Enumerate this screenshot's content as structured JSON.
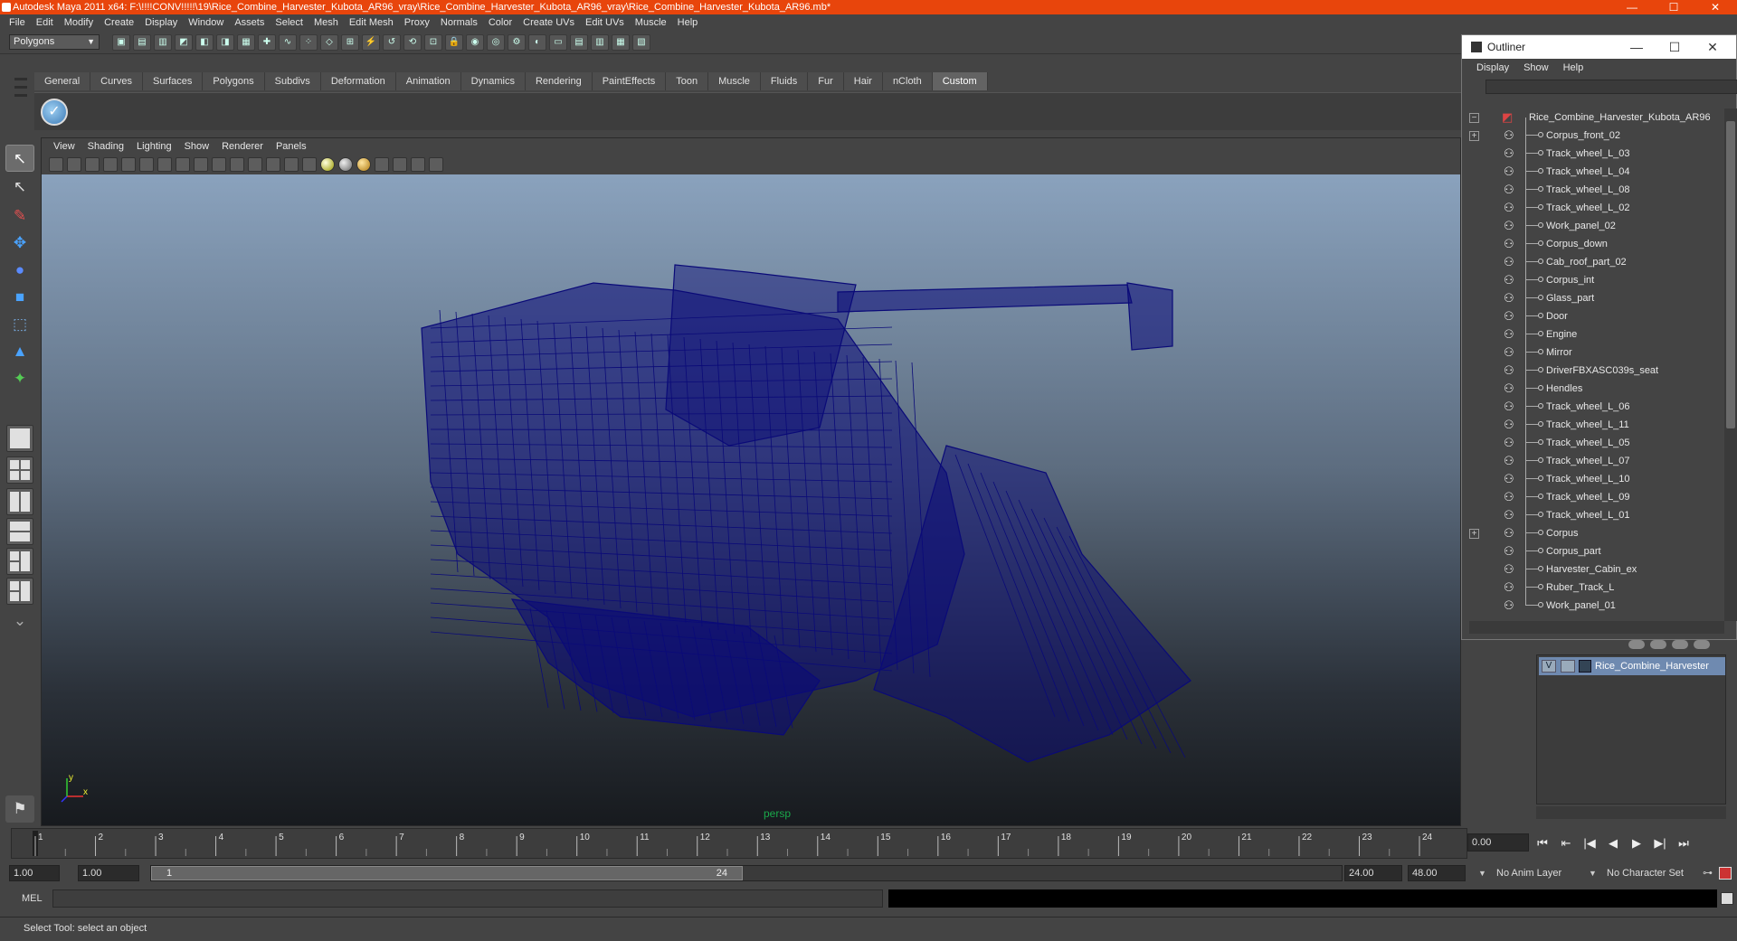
{
  "window": {
    "title": "Autodesk Maya 2011 x64: F:\\!!!!CONV!!!!!\\19\\Rice_Combine_Harvester_Kubota_AR96_vray\\Rice_Combine_Harvester_Kubota_AR96_vray\\Rice_Combine_Harvester_Kubota_AR96.mb*",
    "minimize": "—",
    "maximize": "☐",
    "close": "✕"
  },
  "menubar": [
    "File",
    "Edit",
    "Modify",
    "Create",
    "Display",
    "Window",
    "Assets",
    "Select",
    "Mesh",
    "Edit Mesh",
    "Proxy",
    "Normals",
    "Color",
    "Create UVs",
    "Edit UVs",
    "Muscle",
    "Help"
  ],
  "statusline": {
    "mode": "Polygons",
    "tools": [
      "new-scene-icon",
      "open-scene-icon",
      "save-scene-icon",
      "select-hierarchy-icon",
      "select-object-icon",
      "select-component-icon",
      "select-mask-icon",
      "snap-grid-icon",
      "snap-curve-icon",
      "snap-point-icon",
      "snap-plane-icon",
      "snap-surface-icon",
      "make-live-icon",
      "history-icon",
      "construction-history-icon",
      "input-output-icon",
      "lock-icon",
      "render-current-icon",
      "ipr-render-icon",
      "render-settings-icon",
      "hypershade-icon",
      "render-view-icon",
      "toggle-panel-icon",
      "toggle-attr-icon",
      "toggle-channel-icon",
      "toggle-tool-icon"
    ]
  },
  "shelf": {
    "tabs": [
      "General",
      "Curves",
      "Surfaces",
      "Polygons",
      "Subdivs",
      "Deformation",
      "Animation",
      "Dynamics",
      "Rendering",
      "PaintEffects",
      "Toon",
      "Muscle",
      "Fluids",
      "Fur",
      "Hair",
      "nCloth",
      "Custom"
    ],
    "active_tab": "Custom",
    "tool_glyph": "✓"
  },
  "toolbox": {
    "tools": [
      {
        "name": "select-tool-icon",
        "glyph": "↖",
        "color": "#ffffff"
      },
      {
        "name": "lasso-tool-icon",
        "glyph": "↖",
        "color": "#dddddd"
      },
      {
        "name": "paint-select-tool-icon",
        "glyph": "✎",
        "color": "#e05050"
      },
      {
        "name": "move-tool-icon",
        "glyph": "✥",
        "color": "#4aa3ff"
      },
      {
        "name": "rotate-tool-icon",
        "glyph": "●",
        "color": "#5a8bff"
      },
      {
        "name": "scale-tool-icon",
        "glyph": "■",
        "color": "#4aa3ff"
      },
      {
        "name": "universal-manipulator-icon",
        "glyph": "⬚",
        "color": "#7ad"
      },
      {
        "name": "soft-mod-icon",
        "glyph": "▲",
        "color": "#4aa3ff"
      },
      {
        "name": "show-manipulator-icon",
        "glyph": "✦",
        "color": "#5c5"
      },
      {
        "name": "last-tool-icon",
        "glyph": "",
        "color": "#888"
      }
    ]
  },
  "viewport": {
    "menus": [
      "View",
      "Shading",
      "Lighting",
      "Show",
      "Renderer",
      "Panels"
    ],
    "camera": "persp",
    "axis_x": "x",
    "axis_y": "y",
    "wire_color": "#0a0a78"
  },
  "outliner": {
    "title": "Outliner",
    "menus": [
      "Display",
      "Show",
      "Help"
    ],
    "root": "Rice_Combine_Harvester_Kubota_AR96",
    "items": [
      "Corpus_front_02",
      "Track_wheel_L_03",
      "Track_wheel_L_04",
      "Track_wheel_L_08",
      "Track_wheel_L_02",
      "Work_panel_02",
      "Corpus_down",
      "Cab_roof_part_02",
      "Corpus_int",
      "Glass_part",
      "Door",
      "Engine",
      "Mirror",
      "DriverFBXASC039s_seat",
      "Hendles",
      "Track_wheel_L_06",
      "Track_wheel_L_11",
      "Track_wheel_L_05",
      "Track_wheel_L_07",
      "Track_wheel_L_10",
      "Track_wheel_L_09",
      "Track_wheel_L_01",
      "Corpus",
      "Corpus_part",
      "Harvester_Cabin_ex",
      "Ruber_Track_L",
      "Work_panel_01"
    ],
    "expandable_rows": [
      1,
      23
    ],
    "expander_plus": "+",
    "expander_minus": "−"
  },
  "layers": {
    "name": "Rice_Combine_Harvester",
    "visible_flag": "V"
  },
  "timeline": {
    "ticks": [
      "1",
      "2",
      "3",
      "4",
      "5",
      "6",
      "7",
      "8",
      "9",
      "10",
      "11",
      "12",
      "13",
      "14",
      "15",
      "16",
      "17",
      "18",
      "19",
      "20",
      "21",
      "22",
      "23",
      "24"
    ],
    "current_time": "0.00"
  },
  "playback": [
    "⏮",
    "⇤",
    "|◀",
    "◀",
    "▶",
    "▶|",
    "⏭"
  ],
  "range": {
    "start_time": "1.00",
    "playback_start": "1.00",
    "thumb_start": "1",
    "thumb_end": "24",
    "playback_end": "24.00",
    "end_time": "48.00",
    "anim_layer": "No Anim Layer",
    "character_set": "No Character Set"
  },
  "cmdline": {
    "label": "MEL"
  },
  "helpline": {
    "text": "Select Tool: select an object"
  }
}
